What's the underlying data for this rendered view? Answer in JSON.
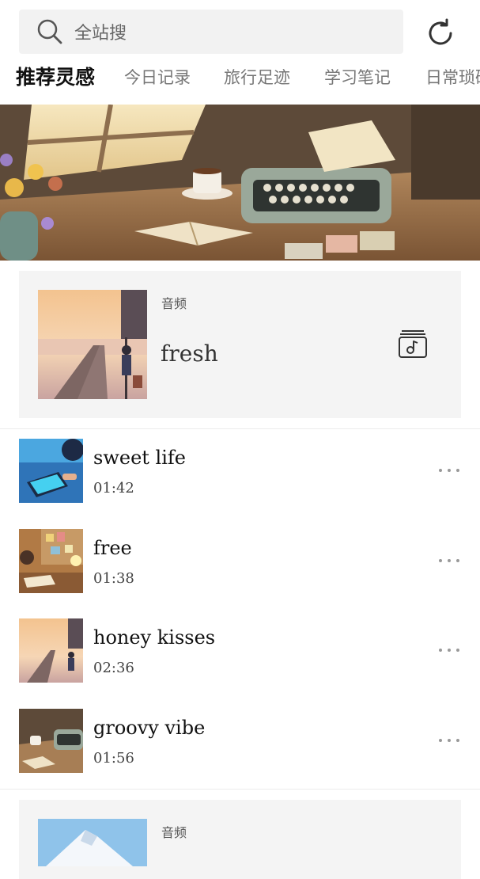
{
  "search": {
    "placeholder": "全站搜",
    "icon": "search-icon"
  },
  "header": {
    "refresh_icon": "refresh-icon"
  },
  "tabs": [
    {
      "label": "推荐灵感",
      "active": true
    },
    {
      "label": "今日记录",
      "active": false
    },
    {
      "label": "旅行足迹",
      "active": false
    },
    {
      "label": "学习笔记",
      "active": false
    },
    {
      "label": "日常琐碎",
      "active": false
    }
  ],
  "hero": {
    "image": "typewriter-desk-illustration"
  },
  "featured": {
    "tag": "音频",
    "title": "fresh",
    "image": "railway-sunset-girl",
    "button_icon": "music-playlist-icon"
  },
  "tracks": [
    {
      "title": "sweet life",
      "duration": "01:42",
      "image": "tablet-drawing-blue"
    },
    {
      "title": "free",
      "duration": "01:38",
      "image": "desk-study-warm"
    },
    {
      "title": "honey kisses",
      "duration": "02:36",
      "image": "railway-sunset-girl"
    },
    {
      "title": "groovy vibe",
      "duration": "01:56",
      "image": "typewriter-desk"
    }
  ],
  "featured2": {
    "tag": "音频",
    "image": "snowy-mountain"
  },
  "colors": {
    "background": "#ffffff",
    "card": "#f4f4f4",
    "search_bg": "#f2f2f2",
    "text_primary": "#111111",
    "text_secondary": "#777777"
  }
}
